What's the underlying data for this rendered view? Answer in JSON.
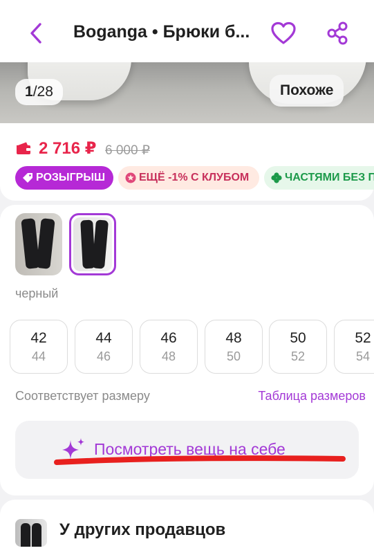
{
  "header": {
    "title": "Boganga • Брюки б...",
    "icons": {
      "back": "chevron-left-icon",
      "favorite": "heart-icon",
      "share": "share-icon"
    },
    "accent_color": "#a339d6"
  },
  "gallery": {
    "current": "1",
    "total": "28",
    "similar_label": "Похоже"
  },
  "pricing": {
    "price": "2 716 ₽",
    "old_price": "6 000 ₽",
    "price_color": "#e8254b"
  },
  "promos": [
    {
      "label": "РОЗЫГРЫШ",
      "icon": "tag-icon"
    },
    {
      "label": "ЕЩЁ -1% С КЛУБОМ",
      "icon": "club-icon"
    },
    {
      "label": "ЧАСТЯМИ БЕЗ П",
      "icon": "clover-icon"
    }
  ],
  "variants": {
    "selected_color": "черный",
    "selected_index": 1
  },
  "sizes": [
    {
      "ru": "42",
      "alt": "44"
    },
    {
      "ru": "44",
      "alt": "46"
    },
    {
      "ru": "46",
      "alt": "48"
    },
    {
      "ru": "48",
      "alt": "50"
    },
    {
      "ru": "50",
      "alt": "52"
    },
    {
      "ru": "52",
      "alt": "54"
    }
  ],
  "fit": {
    "label": "Соответствует размеру",
    "size_table_link": "Таблица размеров"
  },
  "tryon": {
    "label": "Посмотреть вещь на себе",
    "icon": "sparkle-icon",
    "annotation_color": "#e8201e"
  },
  "other_sellers": {
    "label": "У других продавцов"
  }
}
